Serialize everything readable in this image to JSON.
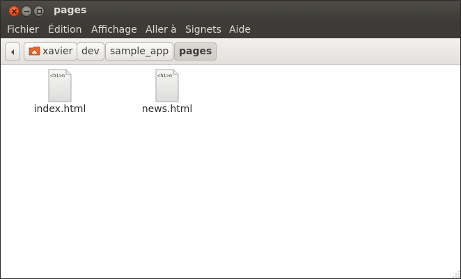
{
  "window": {
    "title": "pages"
  },
  "menubar": {
    "items": [
      "Fichier",
      "Édition",
      "Affichage",
      "Aller à",
      "Signets",
      "Aide"
    ]
  },
  "breadcrumb": {
    "items": [
      "xavier",
      "dev",
      "sample_app",
      "pages"
    ],
    "active": "pages",
    "home_icon": "home-folder-icon"
  },
  "files": [
    {
      "name": "index.html",
      "preview": "<h1>n",
      "icon": "html-file-icon"
    },
    {
      "name": "news.html",
      "preview": "<h1>n",
      "icon": "html-file-icon"
    }
  ],
  "colors": {
    "titlebar": "#3c3b37",
    "close_button": "#e0461b",
    "title_text": "#dfdbd2"
  }
}
